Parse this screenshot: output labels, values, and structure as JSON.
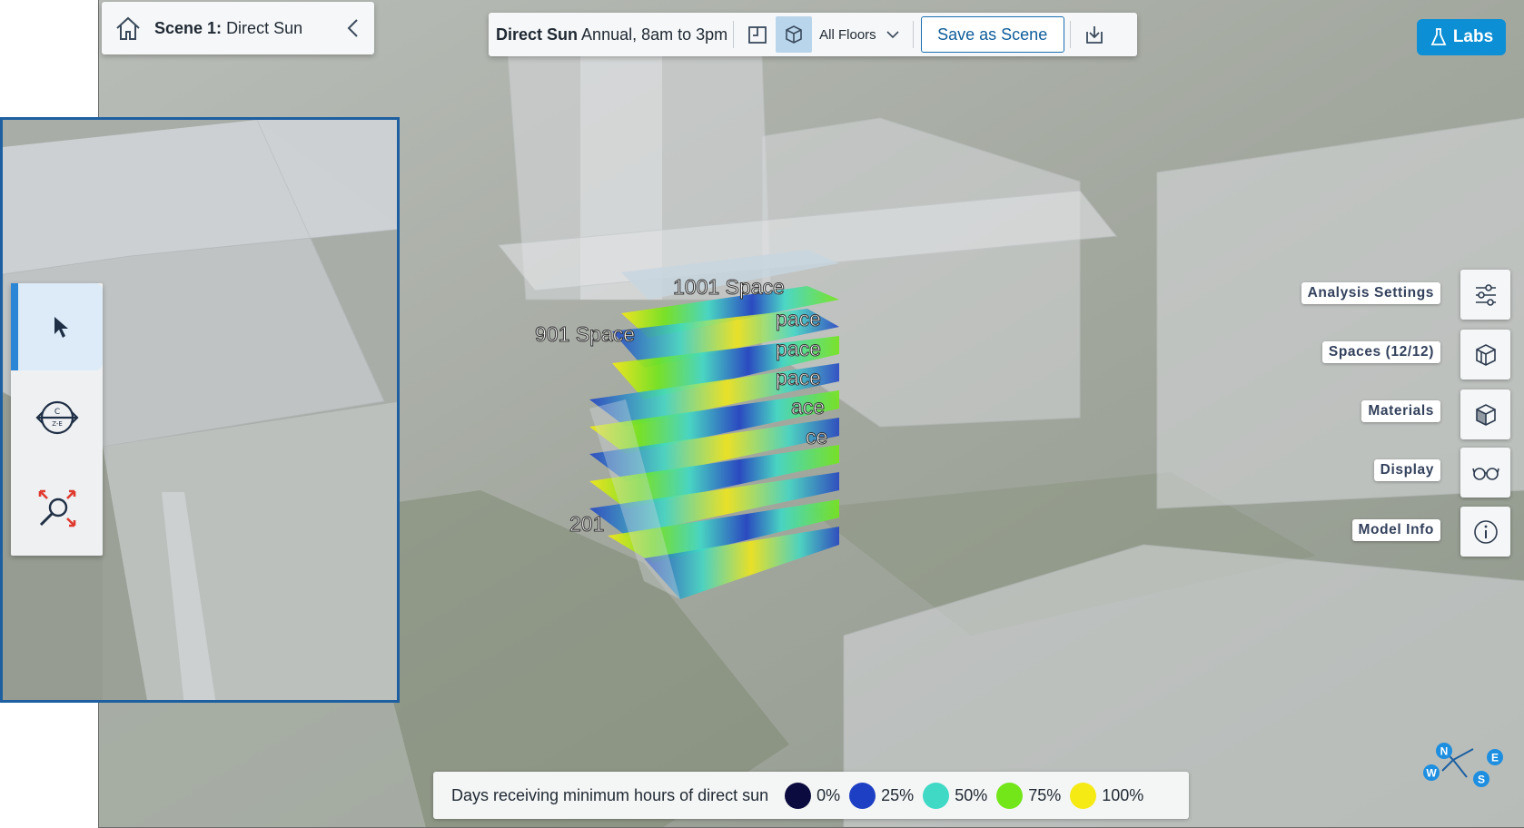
{
  "scene": {
    "name_label": "Scene 1:",
    "name_value": "Direct Sun"
  },
  "analysis": {
    "title_bold": "Direct Sun",
    "title_detail": "Annual, 8am to 3pm",
    "floors_selected": "All Floors",
    "save_label": "Save as Scene"
  },
  "labs": {
    "label": "Labs"
  },
  "viewport": {
    "space_labels": [
      "1001 Space",
      "901 Space",
      "201"
    ],
    "partial_labels": [
      "pace",
      "pace",
      "pace",
      "ace",
      "ce"
    ]
  },
  "side_panel": [
    {
      "label": "Analysis Settings",
      "icon": "sliders-icon"
    },
    {
      "label": "Spaces (12/12)",
      "icon": "spaces-icon"
    },
    {
      "label": "Materials",
      "icon": "materials-icon"
    },
    {
      "label": "Display",
      "icon": "glasses-icon"
    },
    {
      "label": "Model Info",
      "icon": "info-icon"
    }
  ],
  "tools": [
    {
      "name": "select-tool",
      "icon": "cursor-icon",
      "selected": true
    },
    {
      "name": "orbit-tool",
      "icon": "orbit-icon",
      "selected": false
    },
    {
      "name": "zoom-extents-tool",
      "icon": "zoom-extents-icon",
      "selected": false
    }
  ],
  "legend": {
    "title": "Days receiving minimum hours of direct sun",
    "stops": [
      {
        "label": "0%",
        "color": "#0b0b3f"
      },
      {
        "label": "25%",
        "color": "#1d3fc4"
      },
      {
        "label": "50%",
        "color": "#3fd9c6"
      },
      {
        "label": "75%",
        "color": "#73e61a"
      },
      {
        "label": "100%",
        "color": "#f5ea13"
      }
    ]
  },
  "compass": {
    "n": "N",
    "e": "E",
    "s": "S",
    "w": "W"
  },
  "colors": {
    "accent": "#0d8fd5",
    "frame": "#1d5fa0"
  }
}
